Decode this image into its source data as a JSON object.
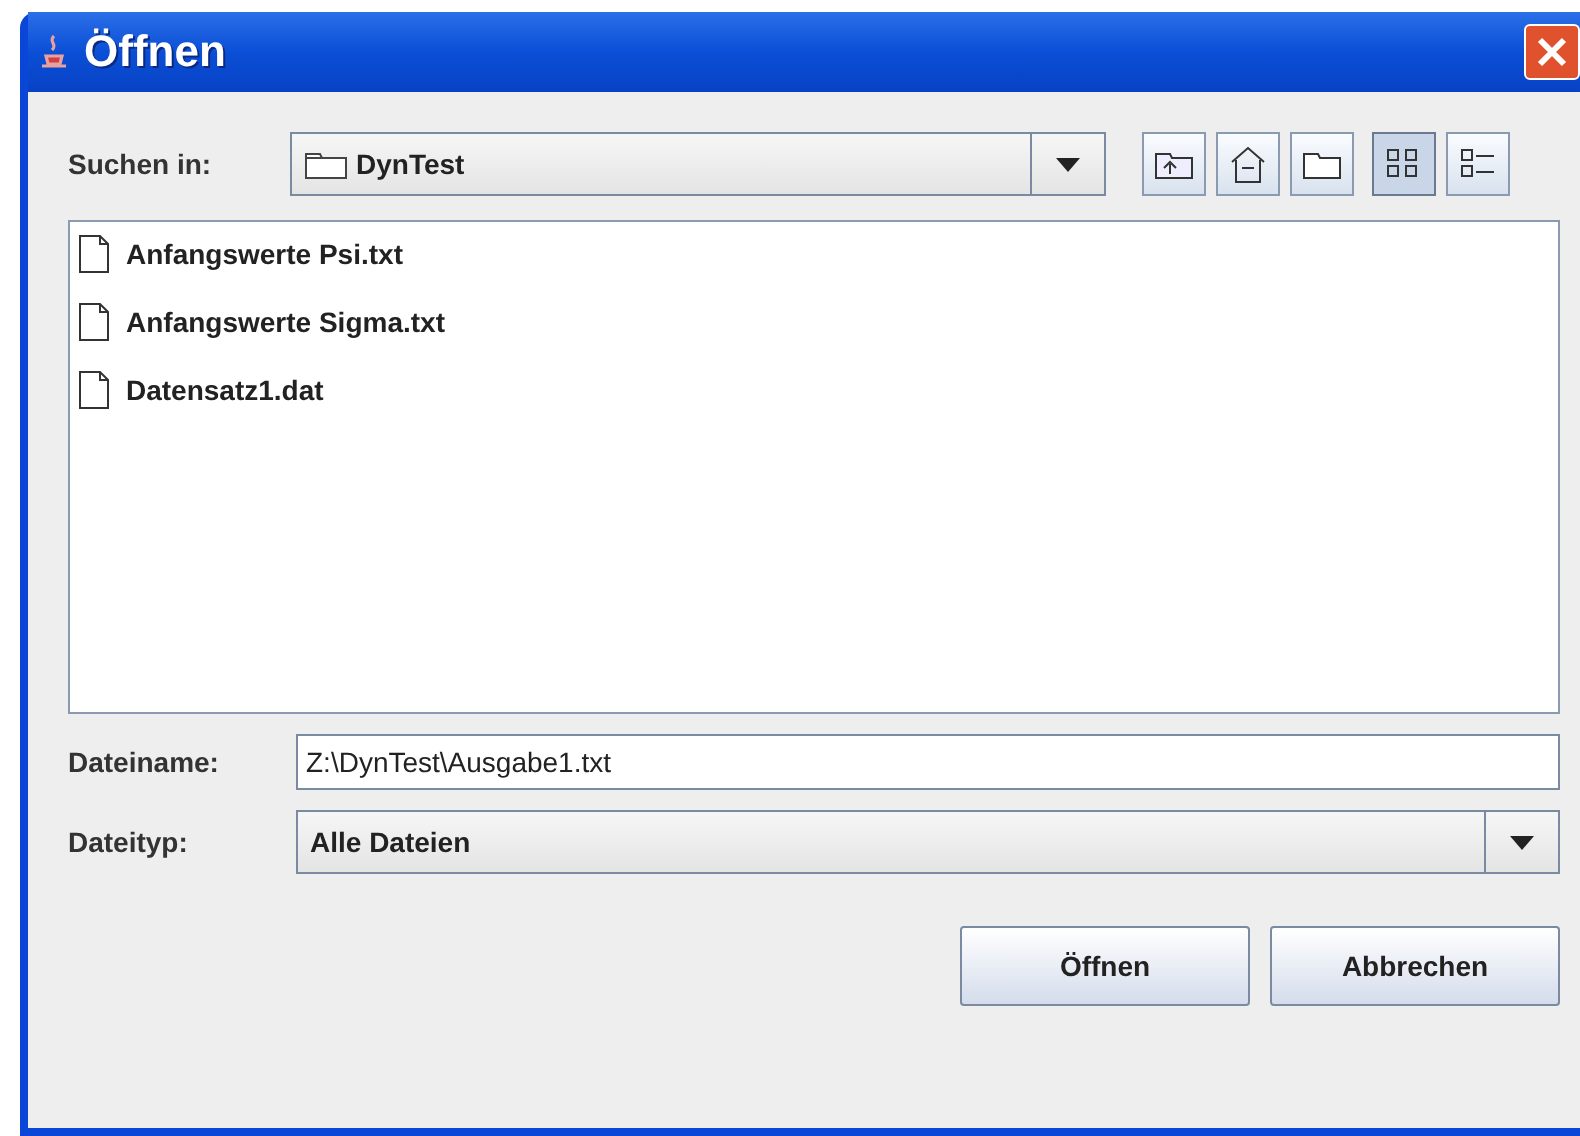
{
  "window": {
    "title": "Öffnen"
  },
  "look_in": {
    "label": "Suchen in:",
    "value": "DynTest"
  },
  "toolbar": [
    {
      "kind": "up"
    },
    {
      "kind": "home"
    },
    {
      "kind": "newfolder"
    },
    {
      "kind": "list",
      "selected": true
    },
    {
      "kind": "details",
      "selected": false
    }
  ],
  "files": [
    {
      "name": "Anfangswerte Psi.txt"
    },
    {
      "name": "Anfangswerte Sigma.txt"
    },
    {
      "name": "Datensatz1.dat"
    }
  ],
  "file_name": {
    "label": "Dateiname:",
    "value": "Z:\\DynTest\\Ausgabe1.txt"
  },
  "file_type": {
    "label": "Dateityp:",
    "value": "Alle Dateien"
  },
  "buttons": [
    "Öffnen",
    "Abbrechen"
  ]
}
